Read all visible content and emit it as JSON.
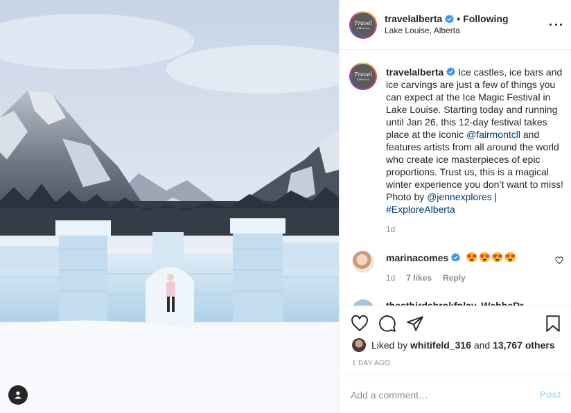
{
  "header": {
    "username": "travelalberta",
    "separator": "•",
    "follow_status": "Following",
    "location": "Lake Louise, Alberta",
    "avatar_logo_line1": "Travel",
    "avatar_logo_line2": "Alberta"
  },
  "caption": {
    "username": "travelalberta",
    "text_1": "Ice castles, ice bars and ice carvings are just a few of things you can expect at the Ice Magic Festival in Lake Louise. Starting today and running until Jan 26, this 12-day festival takes place at the iconic ",
    "mention_1": "@fairmontcll",
    "text_2": " and features artists from all around the world who create ice masterpieces of epic proportions. Trust us, this is a magical winter experience you don’t want to miss! Photo by ",
    "mention_2": "@jennexplores",
    "text_3": " | ",
    "hashtag": "#ExploreAlberta",
    "time": "1d"
  },
  "comments": [
    {
      "username": "marinacomes",
      "text": "😍😍😍😍",
      "time": "1d",
      "likes": "7 likes",
      "reply_label": "Reply"
    },
    {
      "username": "thestbirdsbrokfplay..WebbeRr"
    }
  ],
  "likes": {
    "prefix": "Liked by",
    "user": "whitifeld_316",
    "conjunction": "and",
    "others": "13,767 others"
  },
  "post_date": "1 DAY AGO",
  "add_comment": {
    "placeholder": "Add a comment…",
    "post_label": "Post"
  },
  "colors": {
    "verified": "#3897f0",
    "link": "#00376b",
    "post_disabled": "#b2dffc",
    "meta_gray": "#8e8e8e"
  },
  "icons": [
    "heart-icon",
    "comment-icon",
    "share-icon",
    "bookmark-icon",
    "more-icon",
    "user-tag-icon",
    "verified-badge-icon"
  ]
}
